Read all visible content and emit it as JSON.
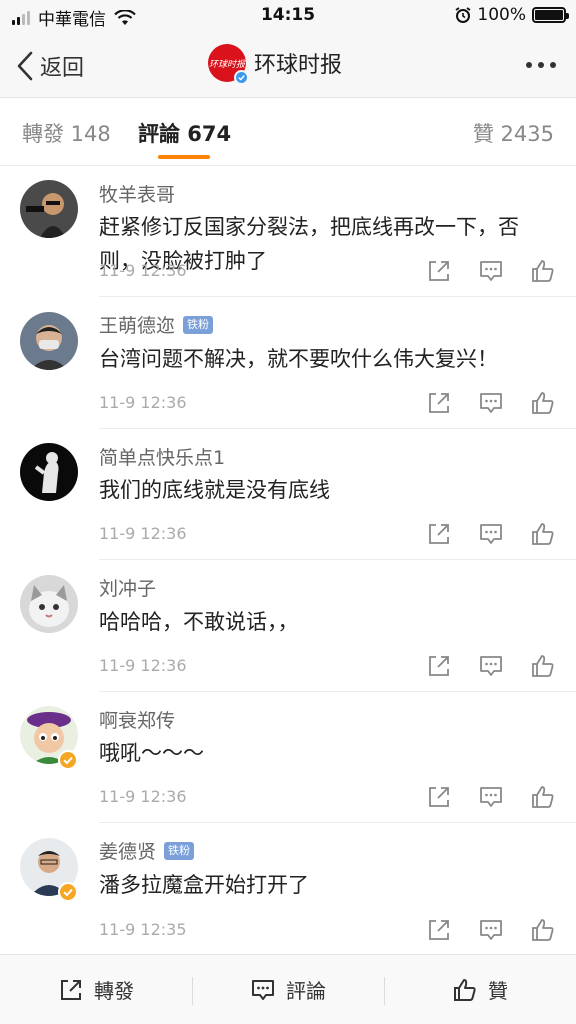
{
  "status_bar": {
    "carrier": "中華電信",
    "time": "14:15",
    "battery_pct": "100%",
    "battery_level": 1.0,
    "signal_bars": 2
  },
  "nav": {
    "back_label": "返回",
    "title": "环球时报",
    "logo_text": "环球时报",
    "brand_color": "#d9121b"
  },
  "tabs": {
    "reposts": "轉發 148",
    "comments": "評論 674",
    "likes": "贊 2435",
    "active": "comments",
    "accent": "#ff8200"
  },
  "comments": [
    {
      "name": "牧羊表哥",
      "text": "赶紧修订反国家分裂法，把底线再改一下，否则，没脸被打肿了",
      "time": "11-9 12:36",
      "badge": ""
    },
    {
      "name": "王萌德迩",
      "text": "台湾问题不解决，就不要吹什么伟大复兴！",
      "time": "11-9 12:36",
      "badge": "铁粉"
    },
    {
      "name": "简单点快乐点1",
      "text": "我们的底线就是没有底线",
      "time": "11-9 12:36",
      "badge": ""
    },
    {
      "name": "刘冲子",
      "text": "哈哈哈，不敢说话，，",
      "time": "11-9 12:36",
      "badge": ""
    },
    {
      "name": "啊衰郑传",
      "text": "哦吼～～～",
      "time": "11-9 12:36",
      "badge": ""
    },
    {
      "name": "姜德贤",
      "text": "潘多拉魔盒开始打开了",
      "time": "11-9 12:35",
      "badge": "铁粉"
    }
  ],
  "bottom_bar": {
    "repost": "轉發",
    "comment": "評論",
    "like": "贊"
  },
  "icons": {
    "back": "chevron-left-icon",
    "more": "more-dots-icon",
    "share": "share-icon",
    "reply": "comment-icon",
    "like": "thumbs-up-icon"
  }
}
